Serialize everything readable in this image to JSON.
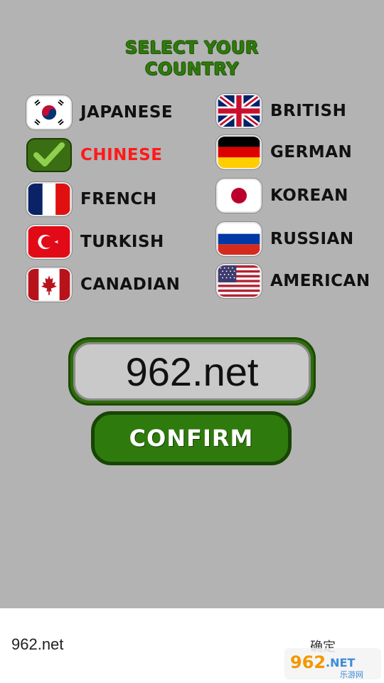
{
  "title": {
    "line1": "SELECT YOUR",
    "line2": "COUNTRY"
  },
  "countries": [
    {
      "label": "JAPANESE",
      "flag": "korea-flag-icon",
      "selected": false
    },
    {
      "label": "CHINESE",
      "flag": "check-icon",
      "selected": true
    },
    {
      "label": "FRENCH",
      "flag": "france-flag-icon",
      "selected": false
    },
    {
      "label": "TURKISH",
      "flag": "turkey-flag-icon",
      "selected": false
    },
    {
      "label": "CANADIAN",
      "flag": "canada-flag-icon",
      "selected": false
    },
    {
      "label": "BRITISH",
      "flag": "uk-flag-icon",
      "selected": false
    },
    {
      "label": "GERMAN",
      "flag": "germany-flag-icon",
      "selected": false
    },
    {
      "label": "KOREAN",
      "flag": "japan-flag-icon",
      "selected": false
    },
    {
      "label": "RUSSIAN",
      "flag": "russia-flag-icon",
      "selected": false
    },
    {
      "label": "AMERICAN",
      "flag": "usa-flag-icon",
      "selected": false
    }
  ],
  "name_input": {
    "value": "962.net"
  },
  "confirm_button": {
    "label": "CONFIRM"
  },
  "bottom_bar": {
    "text": "962.net",
    "confirm_label": "确定",
    "watermark": "962.NET 乐游网"
  },
  "colors": {
    "background": "#b3b3b3",
    "accent_green": "#2f7a0c",
    "selected_red": "#ff1a1a"
  }
}
